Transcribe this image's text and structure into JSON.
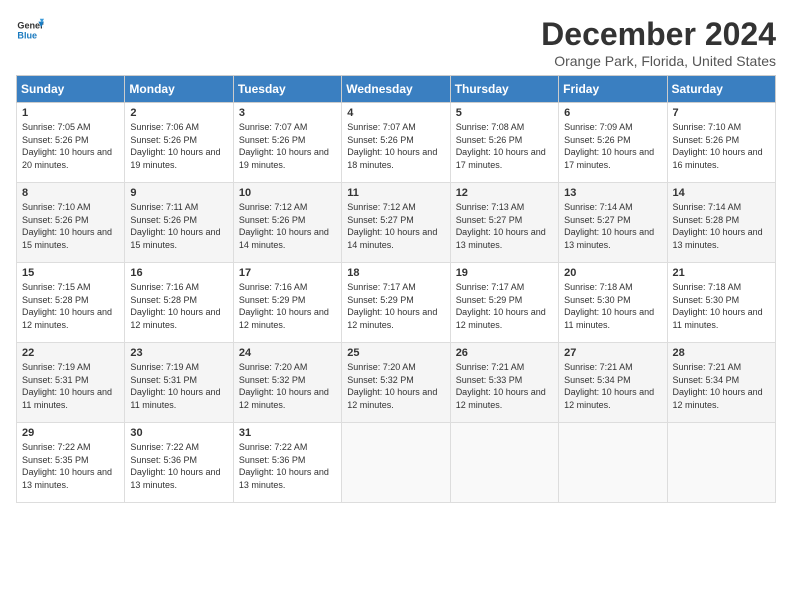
{
  "logo": {
    "line1": "General",
    "line2": "Blue"
  },
  "title": "December 2024",
  "location": "Orange Park, Florida, United States",
  "weekdays": [
    "Sunday",
    "Monday",
    "Tuesday",
    "Wednesday",
    "Thursday",
    "Friday",
    "Saturday"
  ],
  "weeks": [
    [
      {
        "day": "1",
        "sunrise": "Sunrise: 7:05 AM",
        "sunset": "Sunset: 5:26 PM",
        "daylight": "Daylight: 10 hours and 20 minutes."
      },
      {
        "day": "2",
        "sunrise": "Sunrise: 7:06 AM",
        "sunset": "Sunset: 5:26 PM",
        "daylight": "Daylight: 10 hours and 19 minutes."
      },
      {
        "day": "3",
        "sunrise": "Sunrise: 7:07 AM",
        "sunset": "Sunset: 5:26 PM",
        "daylight": "Daylight: 10 hours and 19 minutes."
      },
      {
        "day": "4",
        "sunrise": "Sunrise: 7:07 AM",
        "sunset": "Sunset: 5:26 PM",
        "daylight": "Daylight: 10 hours and 18 minutes."
      },
      {
        "day": "5",
        "sunrise": "Sunrise: 7:08 AM",
        "sunset": "Sunset: 5:26 PM",
        "daylight": "Daylight: 10 hours and 17 minutes."
      },
      {
        "day": "6",
        "sunrise": "Sunrise: 7:09 AM",
        "sunset": "Sunset: 5:26 PM",
        "daylight": "Daylight: 10 hours and 17 minutes."
      },
      {
        "day": "7",
        "sunrise": "Sunrise: 7:10 AM",
        "sunset": "Sunset: 5:26 PM",
        "daylight": "Daylight: 10 hours and 16 minutes."
      }
    ],
    [
      {
        "day": "8",
        "sunrise": "Sunrise: 7:10 AM",
        "sunset": "Sunset: 5:26 PM",
        "daylight": "Daylight: 10 hours and 15 minutes."
      },
      {
        "day": "9",
        "sunrise": "Sunrise: 7:11 AM",
        "sunset": "Sunset: 5:26 PM",
        "daylight": "Daylight: 10 hours and 15 minutes."
      },
      {
        "day": "10",
        "sunrise": "Sunrise: 7:12 AM",
        "sunset": "Sunset: 5:26 PM",
        "daylight": "Daylight: 10 hours and 14 minutes."
      },
      {
        "day": "11",
        "sunrise": "Sunrise: 7:12 AM",
        "sunset": "Sunset: 5:27 PM",
        "daylight": "Daylight: 10 hours and 14 minutes."
      },
      {
        "day": "12",
        "sunrise": "Sunrise: 7:13 AM",
        "sunset": "Sunset: 5:27 PM",
        "daylight": "Daylight: 10 hours and 13 minutes."
      },
      {
        "day": "13",
        "sunrise": "Sunrise: 7:14 AM",
        "sunset": "Sunset: 5:27 PM",
        "daylight": "Daylight: 10 hours and 13 minutes."
      },
      {
        "day": "14",
        "sunrise": "Sunrise: 7:14 AM",
        "sunset": "Sunset: 5:28 PM",
        "daylight": "Daylight: 10 hours and 13 minutes."
      }
    ],
    [
      {
        "day": "15",
        "sunrise": "Sunrise: 7:15 AM",
        "sunset": "Sunset: 5:28 PM",
        "daylight": "Daylight: 10 hours and 12 minutes."
      },
      {
        "day": "16",
        "sunrise": "Sunrise: 7:16 AM",
        "sunset": "Sunset: 5:28 PM",
        "daylight": "Daylight: 10 hours and 12 minutes."
      },
      {
        "day": "17",
        "sunrise": "Sunrise: 7:16 AM",
        "sunset": "Sunset: 5:29 PM",
        "daylight": "Daylight: 10 hours and 12 minutes."
      },
      {
        "day": "18",
        "sunrise": "Sunrise: 7:17 AM",
        "sunset": "Sunset: 5:29 PM",
        "daylight": "Daylight: 10 hours and 12 minutes."
      },
      {
        "day": "19",
        "sunrise": "Sunrise: 7:17 AM",
        "sunset": "Sunset: 5:29 PM",
        "daylight": "Daylight: 10 hours and 12 minutes."
      },
      {
        "day": "20",
        "sunrise": "Sunrise: 7:18 AM",
        "sunset": "Sunset: 5:30 PM",
        "daylight": "Daylight: 10 hours and 11 minutes."
      },
      {
        "day": "21",
        "sunrise": "Sunrise: 7:18 AM",
        "sunset": "Sunset: 5:30 PM",
        "daylight": "Daylight: 10 hours and 11 minutes."
      }
    ],
    [
      {
        "day": "22",
        "sunrise": "Sunrise: 7:19 AM",
        "sunset": "Sunset: 5:31 PM",
        "daylight": "Daylight: 10 hours and 11 minutes."
      },
      {
        "day": "23",
        "sunrise": "Sunrise: 7:19 AM",
        "sunset": "Sunset: 5:31 PM",
        "daylight": "Daylight: 10 hours and 11 minutes."
      },
      {
        "day": "24",
        "sunrise": "Sunrise: 7:20 AM",
        "sunset": "Sunset: 5:32 PM",
        "daylight": "Daylight: 10 hours and 12 minutes."
      },
      {
        "day": "25",
        "sunrise": "Sunrise: 7:20 AM",
        "sunset": "Sunset: 5:32 PM",
        "daylight": "Daylight: 10 hours and 12 minutes."
      },
      {
        "day": "26",
        "sunrise": "Sunrise: 7:21 AM",
        "sunset": "Sunset: 5:33 PM",
        "daylight": "Daylight: 10 hours and 12 minutes."
      },
      {
        "day": "27",
        "sunrise": "Sunrise: 7:21 AM",
        "sunset": "Sunset: 5:34 PM",
        "daylight": "Daylight: 10 hours and 12 minutes."
      },
      {
        "day": "28",
        "sunrise": "Sunrise: 7:21 AM",
        "sunset": "Sunset: 5:34 PM",
        "daylight": "Daylight: 10 hours and 12 minutes."
      }
    ],
    [
      {
        "day": "29",
        "sunrise": "Sunrise: 7:22 AM",
        "sunset": "Sunset: 5:35 PM",
        "daylight": "Daylight: 10 hours and 13 minutes."
      },
      {
        "day": "30",
        "sunrise": "Sunrise: 7:22 AM",
        "sunset": "Sunset: 5:36 PM",
        "daylight": "Daylight: 10 hours and 13 minutes."
      },
      {
        "day": "31",
        "sunrise": "Sunrise: 7:22 AM",
        "sunset": "Sunset: 5:36 PM",
        "daylight": "Daylight: 10 hours and 13 minutes."
      },
      null,
      null,
      null,
      null
    ]
  ]
}
